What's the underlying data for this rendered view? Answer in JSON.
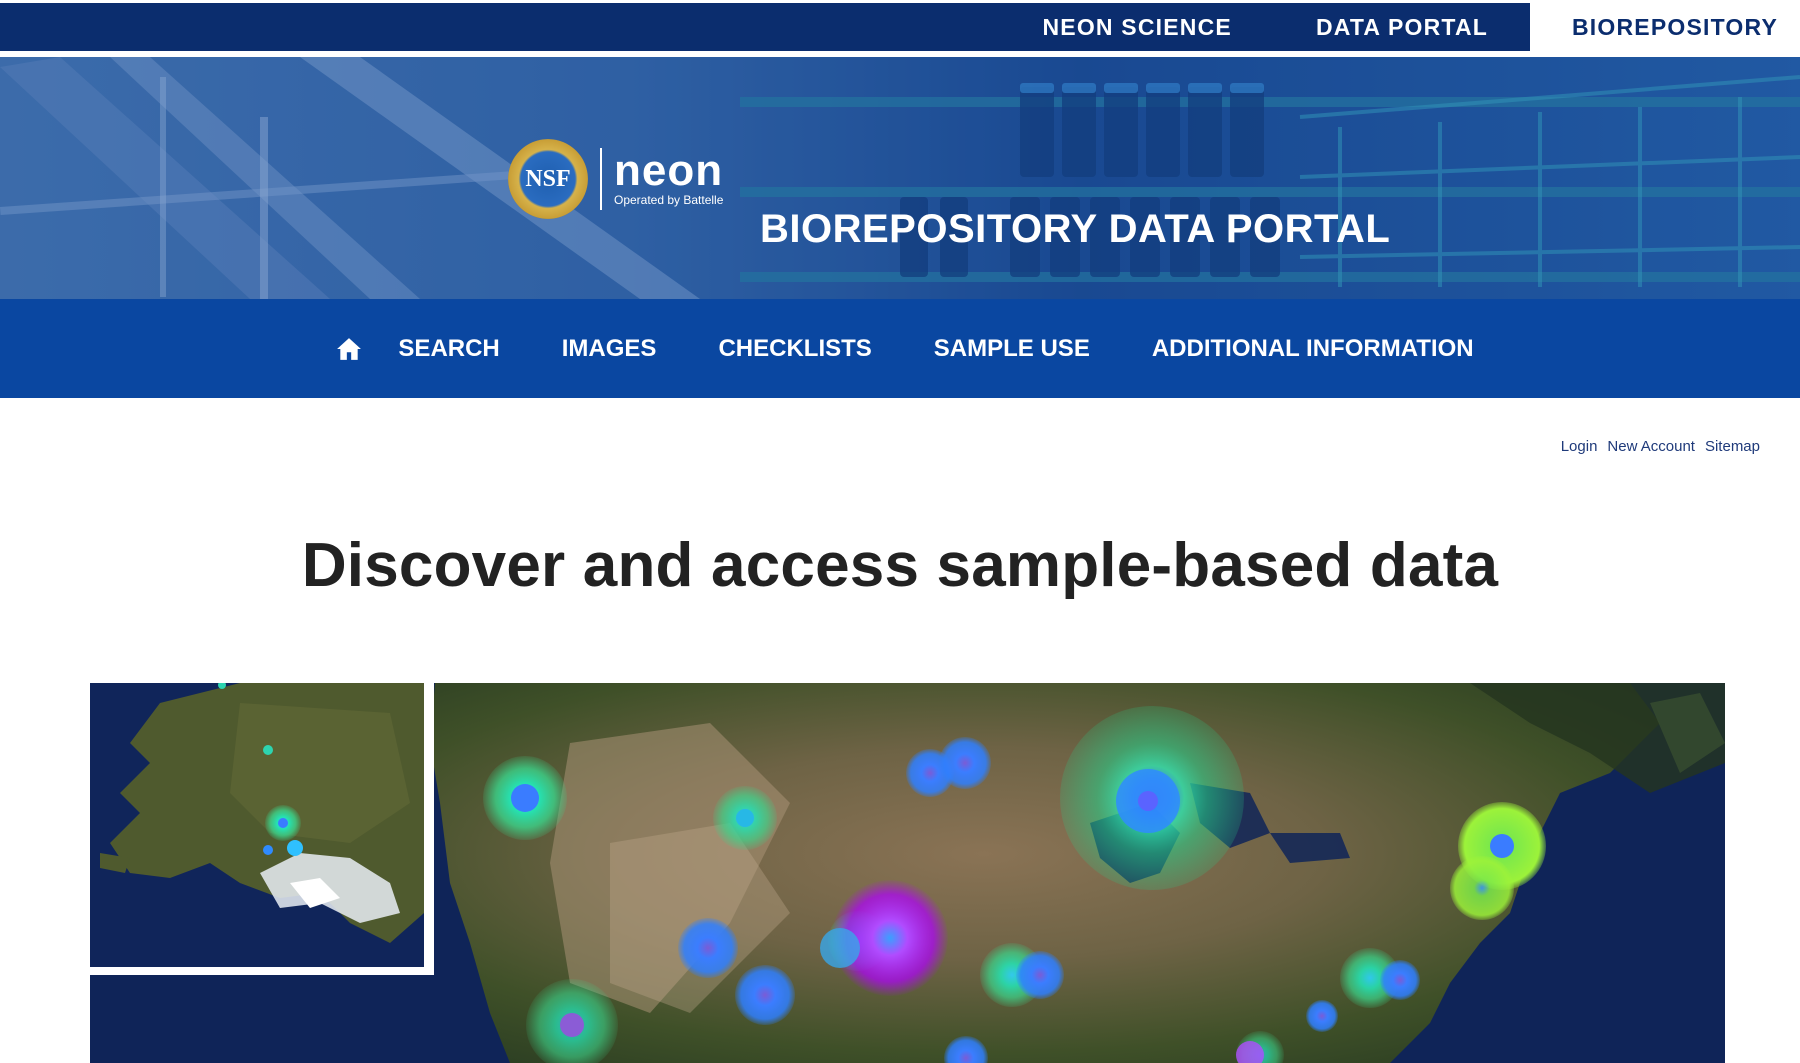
{
  "topbar": {
    "links": [
      {
        "label": "NEON SCIENCE",
        "active": false
      },
      {
        "label": "DATA PORTAL",
        "active": false
      },
      {
        "label": "BIOREPOSITORY",
        "active": true
      }
    ]
  },
  "banner": {
    "logo_text": "NSF",
    "neon_word": "neon",
    "neon_sub": "Operated by Battelle",
    "title": "BIOREPOSITORY DATA PORTAL"
  },
  "mainnav": {
    "home_icon": "home-icon",
    "items": [
      "SEARCH",
      "IMAGES",
      "CHECKLISTS",
      "SAMPLE USE",
      "ADDITIONAL INFORMATION"
    ]
  },
  "util_links": [
    "Login",
    "New Account",
    "Sitemap"
  ],
  "headline": "Discover and access sample-based data",
  "colors": {
    "topbar": "#0b2d6e",
    "nav": "#0a47a1",
    "link": "#1f3a7a",
    "headline": "#222222"
  }
}
